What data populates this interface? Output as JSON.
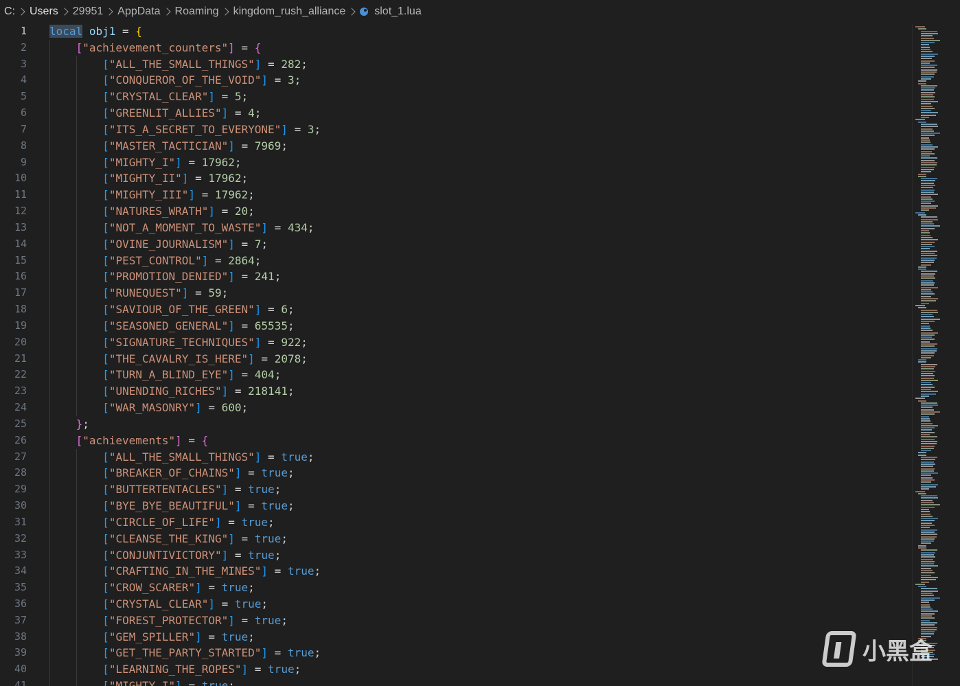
{
  "breadcrumb": {
    "segments": [
      "C:",
      "Users",
      "29951",
      "AppData",
      "Roaming",
      "kingdom_rush_alliance"
    ],
    "file": "slot_1.lua",
    "file_icon": "lua-file-icon"
  },
  "code": {
    "first_line_number": 1,
    "active_line": 1,
    "lines": [
      {
        "indent": 0,
        "tokens": [
          {
            "t": "local",
            "c": "kw sel"
          },
          {
            "t": " "
          },
          {
            "t": "obj1",
            "c": "var"
          },
          {
            "t": " = ",
            "c": "op"
          },
          {
            "t": "{",
            "c": "brace-1"
          }
        ]
      },
      {
        "indent": 1,
        "tokens": [
          {
            "t": "[",
            "c": "brack-2"
          },
          {
            "t": "\"achievement_counters\"",
            "c": "str"
          },
          {
            "t": "]",
            "c": "brack-2"
          },
          {
            "t": " = ",
            "c": "op"
          },
          {
            "t": "{",
            "c": "brack-2"
          }
        ]
      },
      {
        "indent": 2,
        "key": "ALL_THE_SMALL_THINGS",
        "value": "282",
        "vtype": "num"
      },
      {
        "indent": 2,
        "key": "CONQUEROR_OF_THE_VOID",
        "value": "3",
        "vtype": "num"
      },
      {
        "indent": 2,
        "key": "CRYSTAL_CLEAR",
        "value": "5",
        "vtype": "num"
      },
      {
        "indent": 2,
        "key": "GREENLIT_ALLIES",
        "value": "4",
        "vtype": "num"
      },
      {
        "indent": 2,
        "key": "ITS_A_SECRET_TO_EVERYONE",
        "value": "3",
        "vtype": "num"
      },
      {
        "indent": 2,
        "key": "MASTER_TACTICIAN",
        "value": "7969",
        "vtype": "num"
      },
      {
        "indent": 2,
        "key": "MIGHTY_I",
        "value": "17962",
        "vtype": "num"
      },
      {
        "indent": 2,
        "key": "MIGHTY_II",
        "value": "17962",
        "vtype": "num"
      },
      {
        "indent": 2,
        "key": "MIGHTY_III",
        "value": "17962",
        "vtype": "num"
      },
      {
        "indent": 2,
        "key": "NATURES_WRATH",
        "value": "20",
        "vtype": "num"
      },
      {
        "indent": 2,
        "key": "NOT_A_MOMENT_TO_WASTE",
        "value": "434",
        "vtype": "num"
      },
      {
        "indent": 2,
        "key": "OVINE_JOURNALISM",
        "value": "7",
        "vtype": "num"
      },
      {
        "indent": 2,
        "key": "PEST_CONTROL",
        "value": "2864",
        "vtype": "num"
      },
      {
        "indent": 2,
        "key": "PROMOTION_DENIED",
        "value": "241",
        "vtype": "num"
      },
      {
        "indent": 2,
        "key": "RUNEQUEST",
        "value": "59",
        "vtype": "num"
      },
      {
        "indent": 2,
        "key": "SAVIOUR_OF_THE_GREEN",
        "value": "6",
        "vtype": "num"
      },
      {
        "indent": 2,
        "key": "SEASONED_GENERAL",
        "value": "65535",
        "vtype": "num"
      },
      {
        "indent": 2,
        "key": "SIGNATURE_TECHNIQUES",
        "value": "922",
        "vtype": "num"
      },
      {
        "indent": 2,
        "key": "THE_CAVALRY_IS_HERE",
        "value": "2078",
        "vtype": "num"
      },
      {
        "indent": 2,
        "key": "TURN_A_BLIND_EYE",
        "value": "404",
        "vtype": "num"
      },
      {
        "indent": 2,
        "key": "UNENDING_RICHES",
        "value": "218141",
        "vtype": "num"
      },
      {
        "indent": 2,
        "key": "WAR_MASONRY",
        "value": "600",
        "vtype": "num"
      },
      {
        "indent": 1,
        "tokens": [
          {
            "t": "}",
            "c": "brack-2"
          },
          {
            "t": ";",
            "c": "op"
          }
        ]
      },
      {
        "indent": 1,
        "tokens": [
          {
            "t": "[",
            "c": "brack-2"
          },
          {
            "t": "\"achievements\"",
            "c": "str"
          },
          {
            "t": "]",
            "c": "brack-2"
          },
          {
            "t": " = ",
            "c": "op"
          },
          {
            "t": "{",
            "c": "brack-2"
          }
        ]
      },
      {
        "indent": 2,
        "key": "ALL_THE_SMALL_THINGS",
        "value": "true",
        "vtype": "bool"
      },
      {
        "indent": 2,
        "key": "BREAKER_OF_CHAINS",
        "value": "true",
        "vtype": "bool"
      },
      {
        "indent": 2,
        "key": "BUTTERTENTACLES",
        "value": "true",
        "vtype": "bool"
      },
      {
        "indent": 2,
        "key": "BYE_BYE_BEAUTIFUL",
        "value": "true",
        "vtype": "bool"
      },
      {
        "indent": 2,
        "key": "CIRCLE_OF_LIFE",
        "value": "true",
        "vtype": "bool"
      },
      {
        "indent": 2,
        "key": "CLEANSE_THE_KING",
        "value": "true",
        "vtype": "bool"
      },
      {
        "indent": 2,
        "key": "CONJUNTIVICTORY",
        "value": "true",
        "vtype": "bool"
      },
      {
        "indent": 2,
        "key": "CRAFTING_IN_THE_MINES",
        "value": "true",
        "vtype": "bool"
      },
      {
        "indent": 2,
        "key": "CROW_SCARER",
        "value": "true",
        "vtype": "bool"
      },
      {
        "indent": 2,
        "key": "CRYSTAL_CLEAR",
        "value": "true",
        "vtype": "bool"
      },
      {
        "indent": 2,
        "key": "FOREST_PROTECTOR",
        "value": "true",
        "vtype": "bool"
      },
      {
        "indent": 2,
        "key": "GEM_SPILLER",
        "value": "true",
        "vtype": "bool"
      },
      {
        "indent": 2,
        "key": "GET_THE_PARTY_STARTED",
        "value": "true",
        "vtype": "bool"
      },
      {
        "indent": 2,
        "key": "LEARNING_THE_ROPES",
        "value": "true",
        "vtype": "bool"
      },
      {
        "indent": 2,
        "key": "MIGHTY_I",
        "value": "true",
        "vtype": "bool"
      }
    ]
  },
  "watermark": {
    "text": "小黑盒",
    "logo": "xiaoheihe-logo-icon"
  },
  "colors": {
    "background": "#1f1f1f",
    "keyword": "#569cd6",
    "string": "#ce9178",
    "number": "#b5cea8",
    "bracket_level1": "#ffd700",
    "bracket_level2": "#da70d6",
    "bracket_level3": "#179fff",
    "line_number": "#6e7681"
  }
}
